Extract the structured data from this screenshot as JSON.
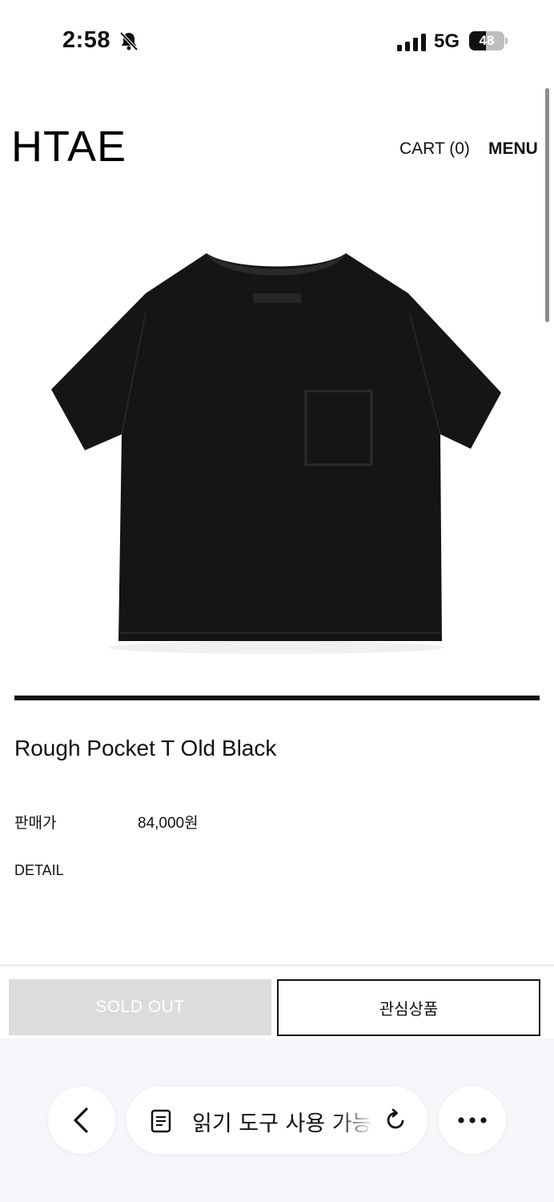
{
  "status_bar": {
    "time": "2:58",
    "network": "5G",
    "battery_level": 48,
    "battery_text": "48",
    "icons": [
      "bell-slash-icon",
      "signal-icon",
      "battery-icon"
    ]
  },
  "header": {
    "logo": "HTAE",
    "cart_label": "CART (0)",
    "menu_label": "MENU"
  },
  "product": {
    "image_icon": "black-tshirt-image",
    "name": "Rough Pocket T Old Black",
    "price_label": "판매가",
    "price_value": "84,000원",
    "detail_label": "DETAIL"
  },
  "actions": {
    "sold_out_label": "SOLD OUT",
    "wishlist_label": "관심상품"
  },
  "browser": {
    "address_text": "읽기 도구 사용 가능",
    "icons": [
      "chevron-left-icon",
      "reader-icon",
      "reload-icon",
      "more-icon"
    ]
  },
  "colors": {
    "sold_out_bg": "#dcdcdc",
    "accent": "#111111",
    "browser_bar_bg": "#f5f6f9"
  }
}
